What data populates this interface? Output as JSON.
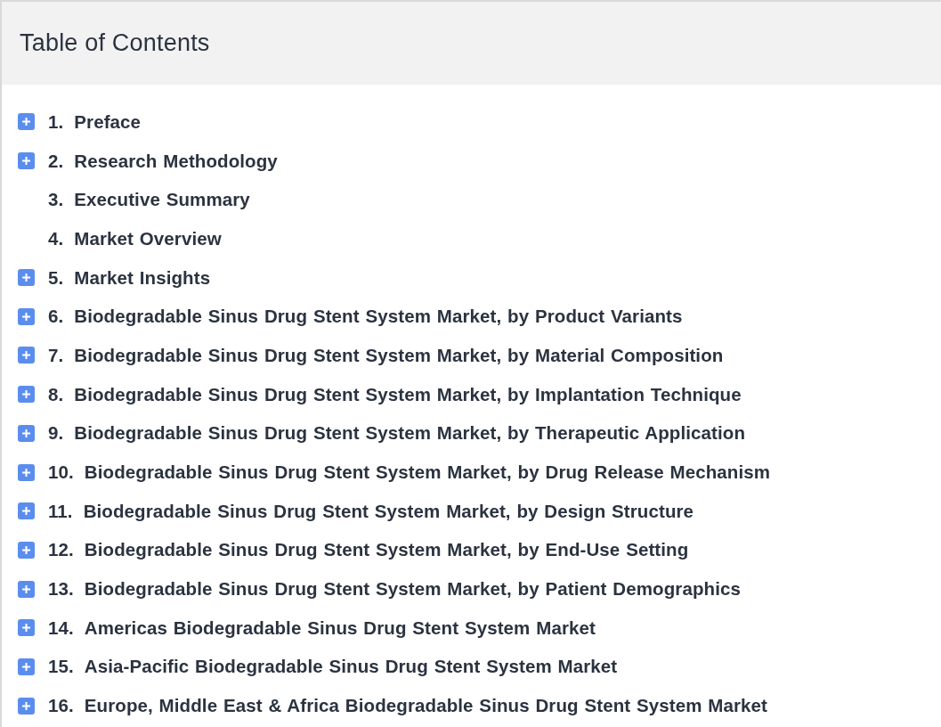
{
  "title": "Table of Contents",
  "items": [
    {
      "number": "1.",
      "label": "Preface",
      "expandable": true
    },
    {
      "number": "2.",
      "label": "Research Methodology",
      "expandable": true
    },
    {
      "number": "3.",
      "label": "Executive Summary",
      "expandable": false
    },
    {
      "number": "4.",
      "label": "Market Overview",
      "expandable": false
    },
    {
      "number": "5.",
      "label": "Market Insights",
      "expandable": true
    },
    {
      "number": "6.",
      "label": "Biodegradable Sinus Drug Stent System Market, by Product Variants",
      "expandable": true
    },
    {
      "number": "7.",
      "label": "Biodegradable Sinus Drug Stent System Market, by Material Composition",
      "expandable": true
    },
    {
      "number": "8.",
      "label": "Biodegradable Sinus Drug Stent System Market, by Implantation Technique",
      "expandable": true
    },
    {
      "number": "9.",
      "label": "Biodegradable Sinus Drug Stent System Market, by Therapeutic Application",
      "expandable": true
    },
    {
      "number": "10.",
      "label": "Biodegradable Sinus Drug Stent System Market, by Drug Release Mechanism",
      "expandable": true
    },
    {
      "number": "11.",
      "label": "Biodegradable Sinus Drug Stent System Market, by Design Structure",
      "expandable": true
    },
    {
      "number": "12.",
      "label": "Biodegradable Sinus Drug Stent System Market, by End-Use Setting",
      "expandable": true
    },
    {
      "number": "13.",
      "label": "Biodegradable Sinus Drug Stent System Market, by Patient Demographics",
      "expandable": true
    },
    {
      "number": "14.",
      "label": "Americas Biodegradable Sinus Drug Stent System Market",
      "expandable": true
    },
    {
      "number": "15.",
      "label": "Asia-Pacific Biodegradable Sinus Drug Stent System Market",
      "expandable": true
    },
    {
      "number": "16.",
      "label": "Europe, Middle East & Africa Biodegradable Sinus Drug Stent System Market",
      "expandable": true
    }
  ]
}
